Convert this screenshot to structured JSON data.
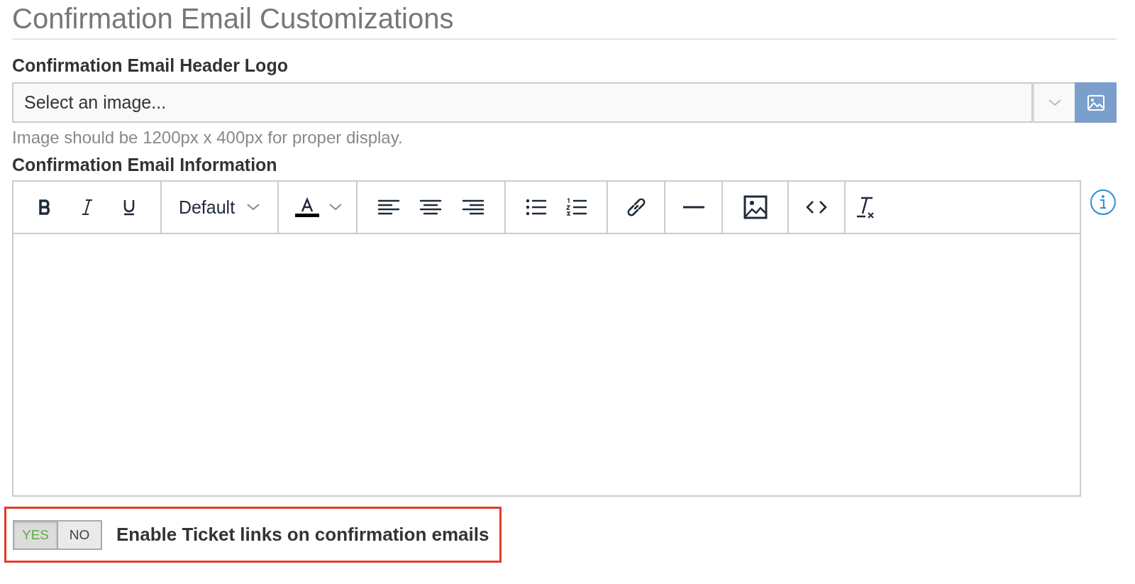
{
  "title": "Confirmation Email Customizations",
  "header_logo": {
    "label": "Confirmation Email Header Logo",
    "placeholder": "Select an image...",
    "help": "Image should be 1200px x 400px for proper display."
  },
  "information": {
    "label": "Confirmation Email Information",
    "font_dropdown": "Default"
  },
  "ticket_links": {
    "options": [
      {
        "label": "YES",
        "selected": true
      },
      {
        "label": "NO",
        "selected": false
      }
    ],
    "label": "Enable Ticket links on confirmation emails"
  }
}
